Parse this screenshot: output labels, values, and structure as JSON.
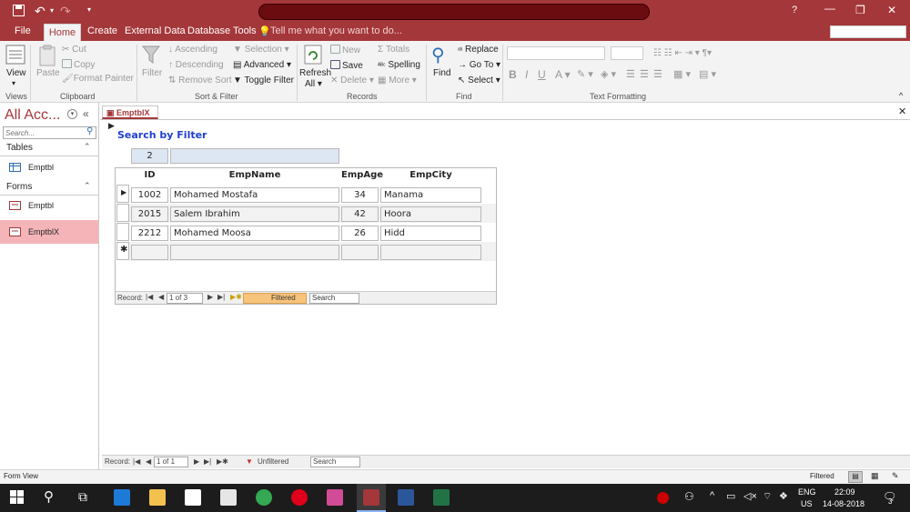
{
  "quick_access": {
    "save_icon": "save-icon",
    "undo_icon": "undo-icon",
    "redo_icon": "redo-icon"
  },
  "window": {
    "help": "?",
    "min": "—",
    "restore": "❐",
    "close": "✕"
  },
  "menu": {
    "file": "File",
    "home": "Home",
    "create": "Create",
    "external": "External Data",
    "dbtools": "Database Tools",
    "tellme": "Tell me what you want to do..."
  },
  "ribbon": {
    "view": {
      "label": "View",
      "group": "Views"
    },
    "clipboard": {
      "paste": "Paste",
      "cut": "Cut",
      "copy": "Copy",
      "format_painter": "Format Painter",
      "group": "Clipboard"
    },
    "sortfilter": {
      "filter": "Filter",
      "ascending": "Ascending",
      "descending": "Descending",
      "remove_sort": "Remove Sort",
      "selection": "Selection",
      "advanced": "Advanced",
      "toggle_filter": "Toggle Filter",
      "group": "Sort & Filter"
    },
    "records": {
      "refresh": "Refresh",
      "all": "All",
      "new": "New",
      "save": "Save",
      "delete": "Delete",
      "totals": "Totals",
      "spelling": "Spelling",
      "more": "More",
      "group": "Records"
    },
    "find": {
      "find": "Find",
      "replace": "Replace",
      "goto": "Go To",
      "select": "Select",
      "group": "Find"
    },
    "text": {
      "group": "Text Formatting",
      "bold": "B",
      "italic": "I",
      "underline": "U"
    }
  },
  "nav": {
    "title": "All Acc...",
    "search_placeholder": "Search...",
    "tables_header": "Tables",
    "table_item": "Emptbl",
    "forms_header": "Forms",
    "form_item1": "Emptbl",
    "form_item2": "EmptblX"
  },
  "form": {
    "tab": "EmptblX",
    "heading": "Search by Filter",
    "search_value": "2",
    "columns": {
      "id": "ID",
      "name": "EmpName",
      "age": "EmpAge",
      "city": "EmpCity"
    },
    "rows": [
      {
        "id": "1002",
        "name": "Mohamed Mostafa",
        "age": "34",
        "city": "Manama"
      },
      {
        "id": "2015",
        "name": "Salem Ibrahim",
        "age": "42",
        "city": "Hoora"
      },
      {
        "id": "2212",
        "name": "Mohamed Moosa",
        "age": "26",
        "city": "Hidd"
      }
    ],
    "subnav": {
      "record": "Record:",
      "pos": "1 of 3",
      "filtered": "Filtered",
      "search": "Search"
    }
  },
  "mainnav": {
    "record": "Record:",
    "pos": "1 of 1",
    "unfiltered": "Unfiltered",
    "search": "Search"
  },
  "status": {
    "left": "Form View",
    "right": "Filtered"
  },
  "taskbar": {
    "lang1": "ENG",
    "lang2": "US",
    "time": "22:09",
    "date": "14-08-2018",
    "notif": "3"
  }
}
